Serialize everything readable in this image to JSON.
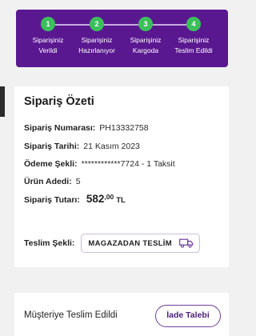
{
  "progress": {
    "steps": [
      {
        "number": "1",
        "line1": "Siparişiniz",
        "line2": "Verildi"
      },
      {
        "number": "2",
        "line1": "Siparişiniz",
        "line2": "Hazırlanıyor"
      },
      {
        "number": "3",
        "line1": "Siparişiniz",
        "line2": "Kargoda"
      },
      {
        "number": "4",
        "line1": "Siparişiniz",
        "line2": "Teslim Edildi"
      }
    ],
    "completed_steps": 4
  },
  "summary": {
    "title": "Sipariş Özeti",
    "order_number_label": "Sipariş Numarası:",
    "order_number": "PH13332758",
    "order_date_label": "Sipariş Tarihi:",
    "order_date": "21 Kasım 2023",
    "payment_label": "Ödeme Şekli:",
    "payment_value": "************7724 - 1 Taksit",
    "item_count_label": "Ürün Adedi:",
    "item_count": "5",
    "total_label": "Sipariş Tutarı:",
    "total_main": "582",
    "total_decimal": ",00",
    "total_currency": "TL",
    "delivery_label": "Teslim Şekli:",
    "delivery_value": "MAGAZADAN TESLİM",
    "delivery_icon": "truck-icon"
  },
  "delivery_status": {
    "text": "Müşteriye Teslim Edildi",
    "return_button": "İade Talebi"
  },
  "colors": {
    "tracker_bg": "#5a1890",
    "step_complete": "#3bbf5b",
    "accent": "#4b1f7d"
  }
}
